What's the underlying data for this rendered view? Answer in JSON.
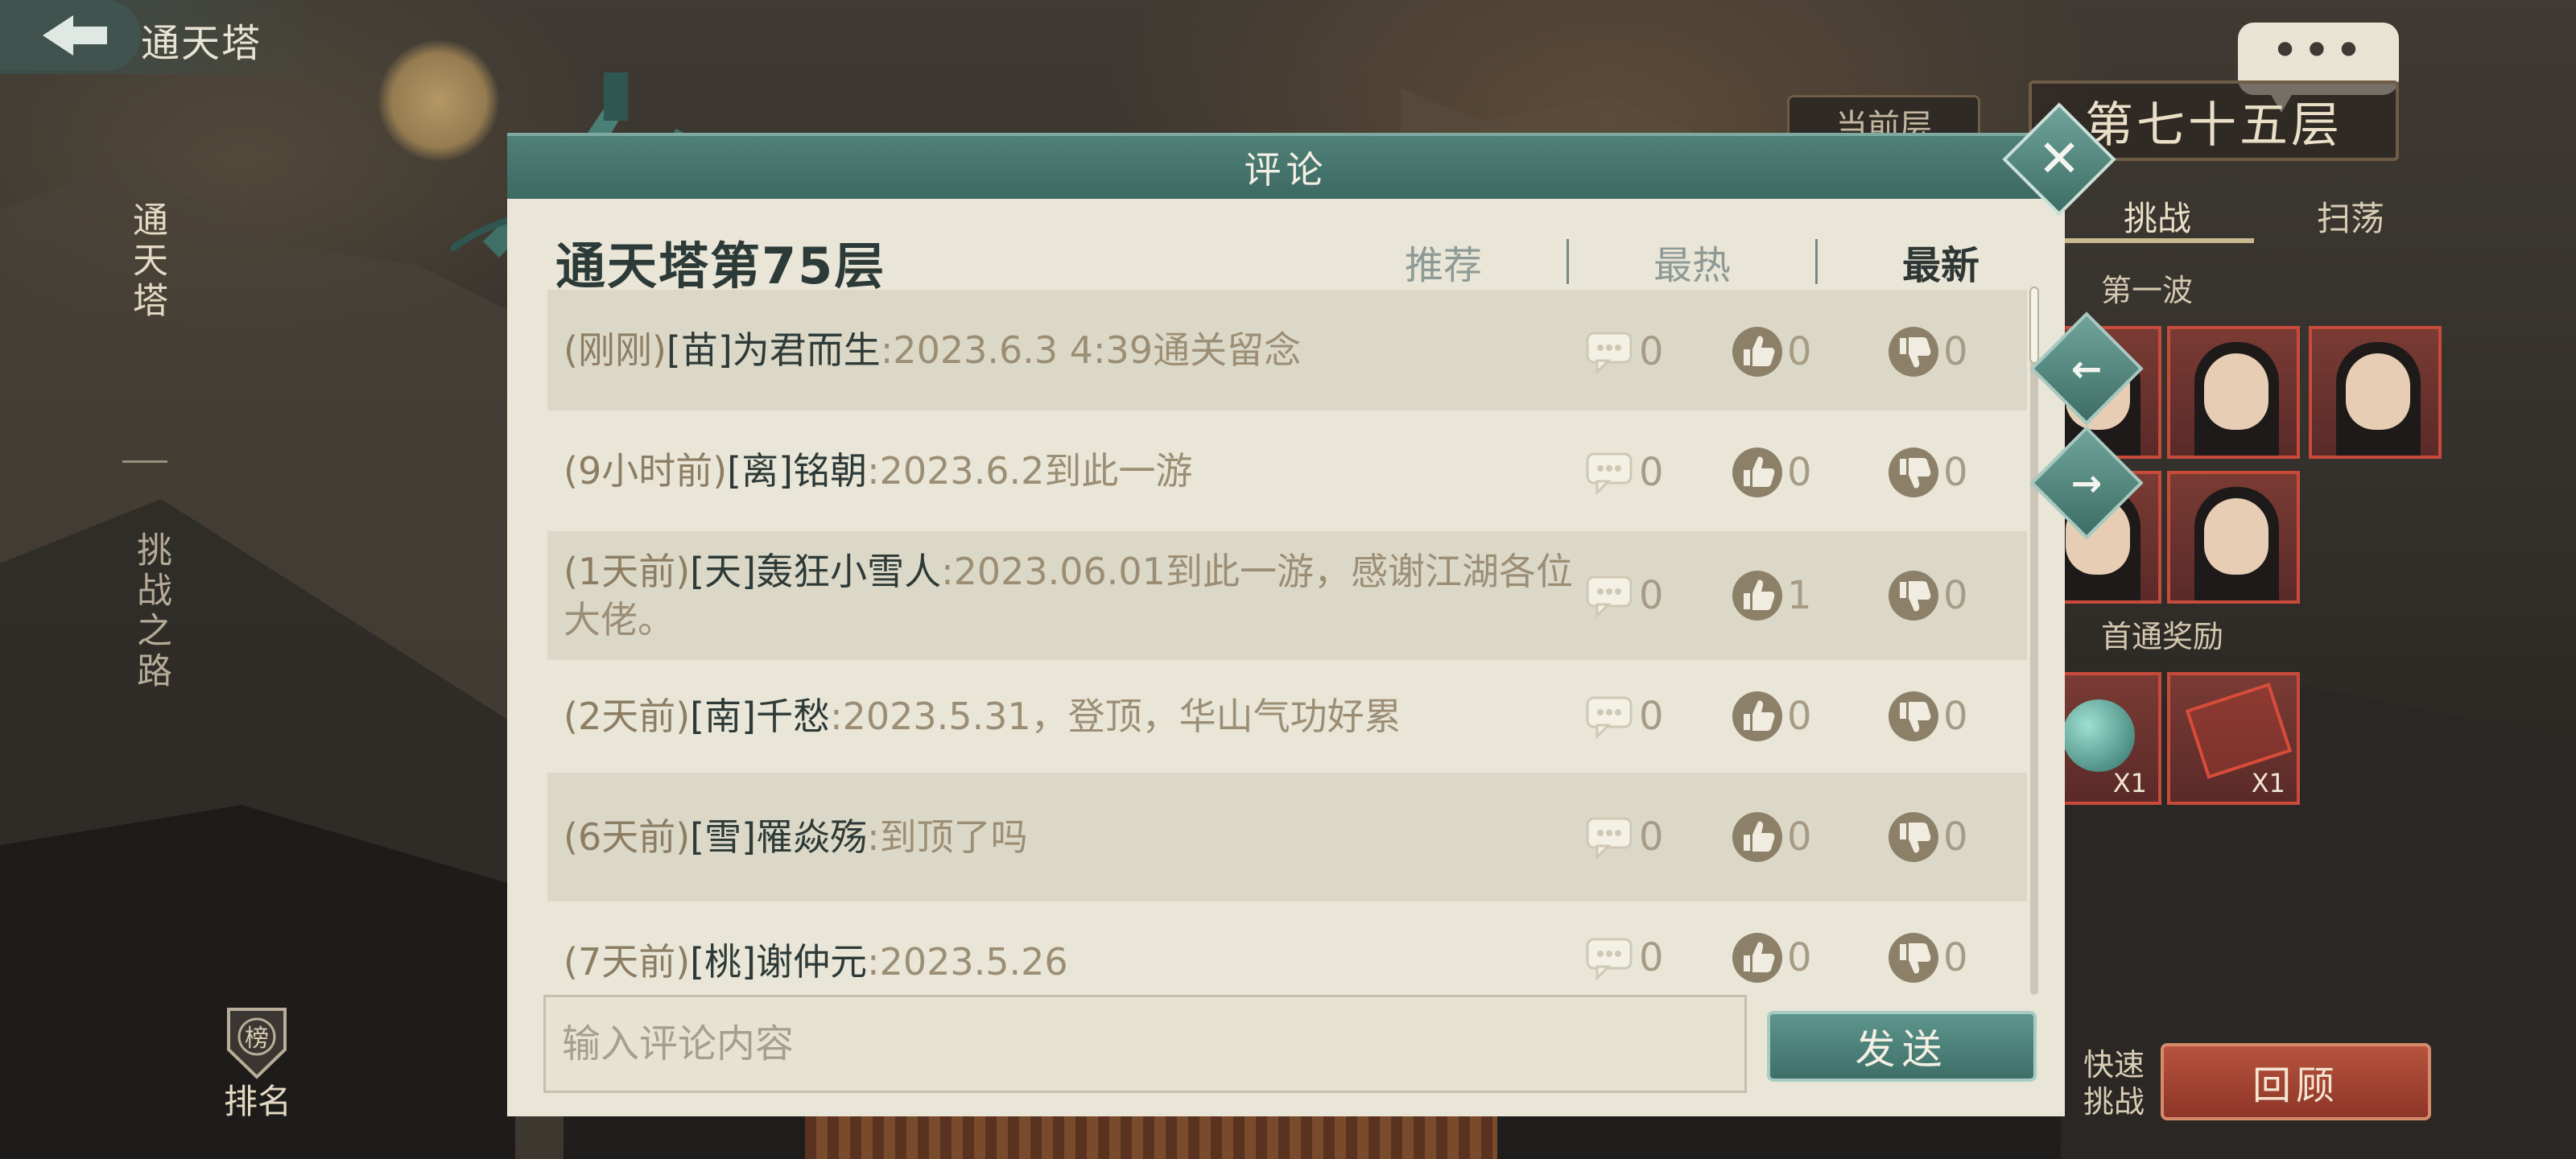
{
  "top_bar": {
    "title": "通天塔"
  },
  "left_nav": {
    "tower_label": "通天塔",
    "road_label": "挑战之路",
    "rank_label": "排名",
    "rank_badge": "榜"
  },
  "right_panel": {
    "current_floor_tag": "当前层",
    "floor_title": "第七十五层",
    "tabs": [
      "挑战",
      "扫荡"
    ],
    "wave_label": "第一波",
    "reward_label": "首通奖励",
    "reward_qty": [
      "X1",
      "X1"
    ],
    "fast_battle_label": "快速挑战",
    "review_button": "回顾"
  },
  "modal": {
    "header_title": "评论",
    "section_title": "通天塔第75层",
    "sort_tabs": [
      "推荐",
      "最热",
      "最新"
    ],
    "active_sort": "最新",
    "comments": [
      {
        "time": "(刚刚)",
        "user": "[苗]为君而生",
        "text": ":2023.6.3 4:39通关留念",
        "replies": "0",
        "likes": "0",
        "dislikes": "0"
      },
      {
        "time": "(9小时前)",
        "user": "[离]铭朝",
        "text": ":2023.6.2到此一游",
        "replies": "0",
        "likes": "0",
        "dislikes": "0"
      },
      {
        "time": "(1天前)",
        "user": "[天]轰狂小雪人",
        "text": ":2023.06.01到此一游，感谢江湖各位大佬。",
        "replies": "0",
        "likes": "1",
        "dislikes": "0"
      },
      {
        "time": "(2天前)",
        "user": "[南]千愁",
        "text": ":2023.5.31，登顶，华山气功好累",
        "replies": "0",
        "likes": "0",
        "dislikes": "0"
      },
      {
        "time": "(6天前)",
        "user": "[雪]罹焱殇",
        "text": ":到顶了吗",
        "replies": "0",
        "likes": "0",
        "dislikes": "0"
      },
      {
        "time": "(7天前)",
        "user": "[桃]谢仲元",
        "text": ":2023.5.26",
        "replies": "0",
        "likes": "0",
        "dislikes": "0"
      }
    ],
    "input_placeholder": "输入评论内容",
    "send_label": "发送"
  },
  "nav_arrows": {
    "prev": "←",
    "next": "→"
  },
  "colors": {
    "modal_header": "#4f8078",
    "modal_body": "#e9e6d8",
    "accent_red": "#b7533e",
    "user_name": "#2d3a37",
    "comment_text": "#9c8e75"
  }
}
